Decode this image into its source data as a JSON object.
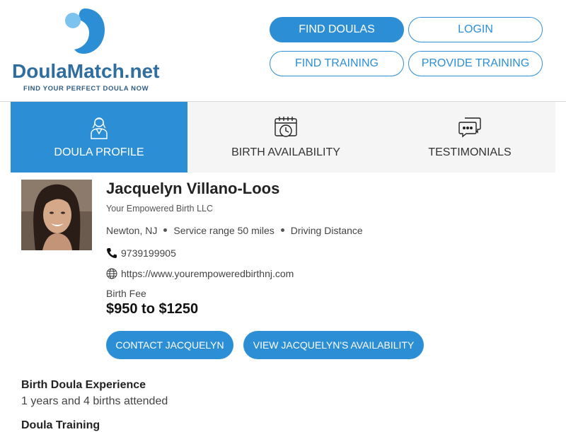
{
  "brand": {
    "name": "DoulaMatch.net",
    "tagline": "FIND YOUR PERFECT DOULA NOW",
    "logo_icon": "doula-logo-mark",
    "accent_color": "#2c8fd6",
    "logo_color": "#2f6e9e"
  },
  "nav": {
    "find_doulas": "FIND DOULAS",
    "login": "LOGIN",
    "find_training": "FIND TRAINING",
    "provide_training": "PROVIDE TRAINING"
  },
  "tabs": [
    {
      "label": "DOULA PROFILE",
      "icon": "doula-person-icon",
      "active": true
    },
    {
      "label": "BIRTH AVAILABILITY",
      "icon": "calendar-clock-icon",
      "active": false
    },
    {
      "label": "TESTIMONIALS",
      "icon": "chat-bubbles-icon",
      "active": false
    }
  ],
  "profile": {
    "name": "Jacquelyn Villano-Loos",
    "company": "Your Empowered Birth LLC",
    "location": "Newton, NJ",
    "service_range": "Service range 50 miles",
    "distance_type": "Driving Distance",
    "phone": "9739199905",
    "website": "https://www.yourempoweredbirthnj.com",
    "fee_label": "Birth Fee",
    "fee_value": "$950 to $1250",
    "contact_button": "CONTACT JACQUELYN",
    "availability_button": "VIEW JACQUELYN'S AVAILABILITY"
  },
  "sections": {
    "experience_title": "Birth Doula Experience",
    "experience_text": "1 years and 4 births attended",
    "training_title": "Doula Training"
  }
}
